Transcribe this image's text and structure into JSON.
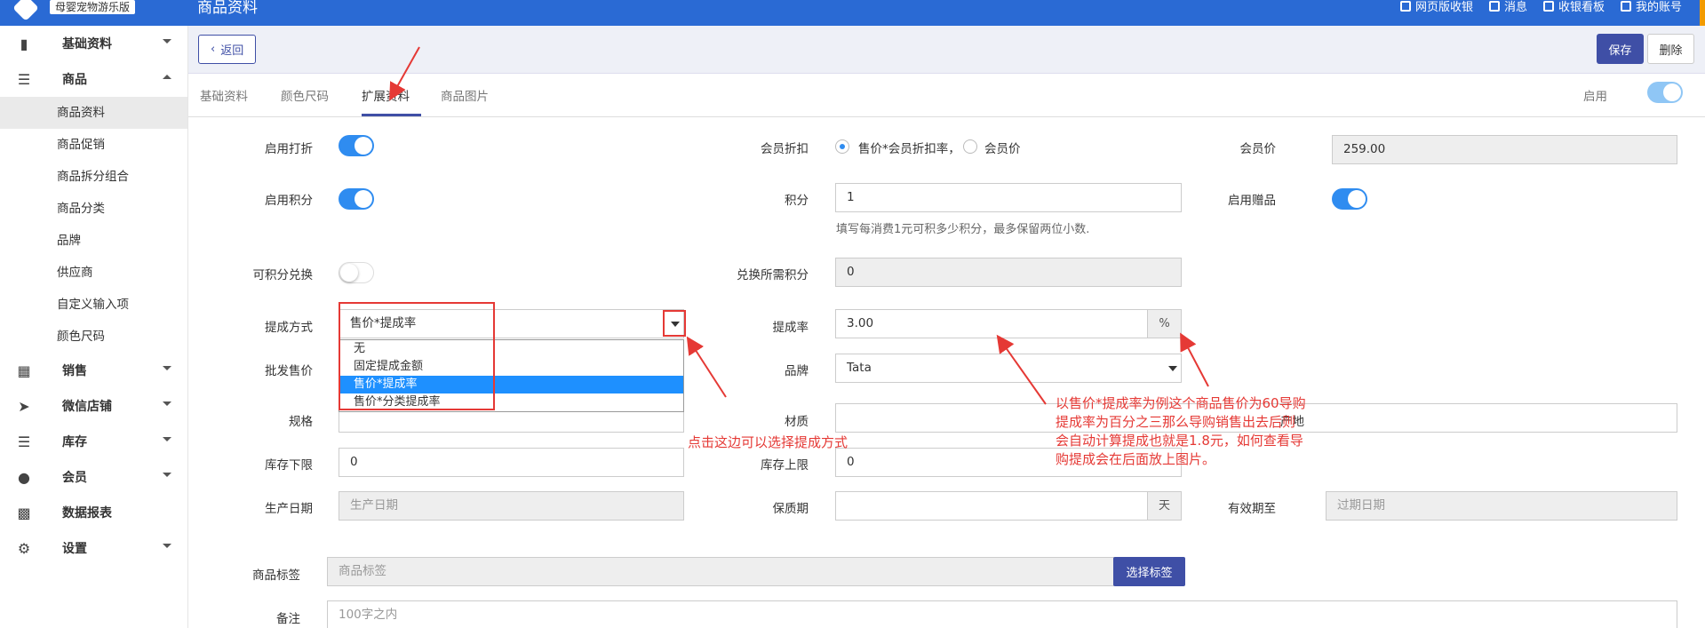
{
  "topbar": {
    "brand": "母婴宠物游乐版",
    "page_title": "商品资料",
    "links": [
      "网页版收银",
      "消息",
      "收银看板",
      "我的账号"
    ]
  },
  "sidebar": {
    "groups": [
      {
        "label": "基础资料"
      },
      {
        "label": "商品"
      },
      {
        "label": "销售"
      },
      {
        "label": "微信店铺"
      },
      {
        "label": "库存"
      },
      {
        "label": "会员"
      },
      {
        "label": "数据报表"
      },
      {
        "label": "设置"
      }
    ],
    "goods_items": [
      "商品资料",
      "商品促销",
      "商品拆分组合",
      "商品分类",
      "品牌",
      "供应商",
      "自定义输入项",
      "颜色尺码"
    ]
  },
  "actions": {
    "back": "返回",
    "save": "保存",
    "delete": "删除"
  },
  "tabs": [
    "基础资料",
    "颜色尺码",
    "扩展资料",
    "商品图片"
  ],
  "enable_label": "启用",
  "form": {
    "enable_discount": "启用打折",
    "member_discount": "会员折扣",
    "radio_1": "售价*会员折扣率，",
    "radio_2": "会员价",
    "member_price_label": "会员价",
    "member_price": "259.00",
    "enable_points": "启用积分",
    "points_label": "积分",
    "points_value": "1",
    "points_help": "填写每消费1元可积多少积分，最多保留两位小数.",
    "enable_gift": "启用赠品",
    "points_exchange": "可积分兑换",
    "exchange_points_label": "兑换所需积分",
    "exchange_points_value": "0",
    "commission_method_label": "提成方式",
    "commission_method_value": "售价*提成率",
    "commission_options": [
      "无",
      "固定提成金额",
      "售价*提成率",
      "售价*分类提成率"
    ],
    "commission_rate_label": "提成率",
    "commission_rate_value": "3.00",
    "percent": "%",
    "wholesale_label": "批发售价",
    "brand_label": "品牌",
    "brand_value": "Tata",
    "spec_label": "规格",
    "material_label": "材质",
    "material_overlay": "产地",
    "stock_min_label": "库存下限",
    "stock_min_value": "0",
    "stock_max_label": "库存上限",
    "stock_max_value": "0",
    "prod_date_label": "生产日期",
    "prod_date_ph": "生产日期",
    "shelf_label": "保质期",
    "shelf_unit": "天",
    "expire_label": "有效期至",
    "expire_ph": "过期日期",
    "tag_label": "商品标签",
    "tag_ph": "商品标签",
    "tag_button": "选择标签",
    "remark_label": "备注",
    "remark_ph": "100字之内"
  },
  "annotations": {
    "note1": "点击这边可以选择提成方式",
    "note2_lines": [
      "以售价*提成率为例这个商品售价为60导购",
      "提成率为百分之三那么导购销售出去后则",
      "会自动计算提成也就是1.8元，如何查看导",
      "购提成会在后面放上图片。"
    ]
  },
  "colors": {
    "primary_blue": "#2a6ad4",
    "button_indigo": "#3f4fa6",
    "toggle_blue": "#2f8cf0",
    "annotation_red": "#e53935"
  }
}
